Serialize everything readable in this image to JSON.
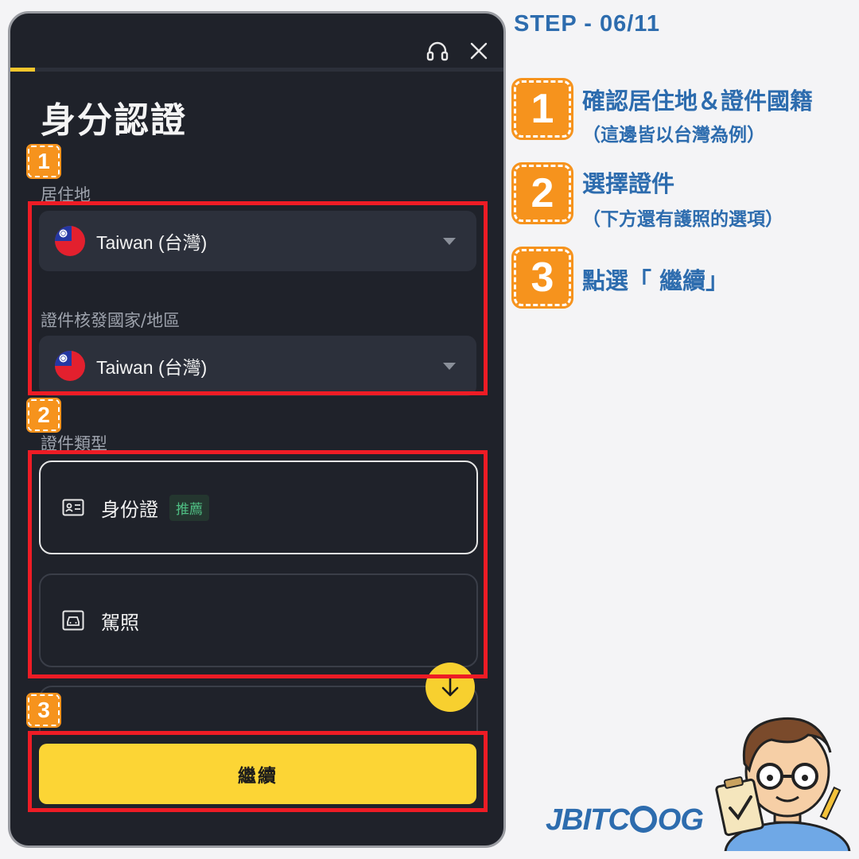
{
  "dialog": {
    "title": "身分認證",
    "progress_percent": 5,
    "residence": {
      "label": "居住地",
      "value": "Taiwan (台灣)"
    },
    "issuing_country": {
      "label": "證件核發國家/地區",
      "value": "Taiwan (台灣)"
    },
    "document_type": {
      "label": "證件類型",
      "options": [
        {
          "label": "身份證",
          "badge": "推薦",
          "selected": true,
          "icon": "id-card-icon"
        },
        {
          "label": "駕照",
          "selected": false,
          "icon": "car-license-icon"
        }
      ]
    },
    "continue_label": "繼續"
  },
  "annotations": {
    "badges": [
      "1",
      "2",
      "3"
    ]
  },
  "guide": {
    "step_label": "STEP - 06/11",
    "steps": [
      {
        "number": "1",
        "title": "確認居住地＆證件國籍",
        "subtitle": "（這邊皆以台灣為例）"
      },
      {
        "number": "2",
        "title": "選擇證件",
        "subtitle": "（下方還有護照的選項）"
      },
      {
        "number": "3",
        "title": "點選「 繼續」"
      }
    ],
    "logo_text": "JBITCLOG"
  },
  "colors": {
    "accent_yellow": "#fcd535",
    "panel_bg": "#1f222a",
    "highlight_red": "#ee1c25",
    "badge_orange": "#f6931d",
    "guide_blue": "#2d6cae",
    "recommend_green": "#4fbf83"
  }
}
